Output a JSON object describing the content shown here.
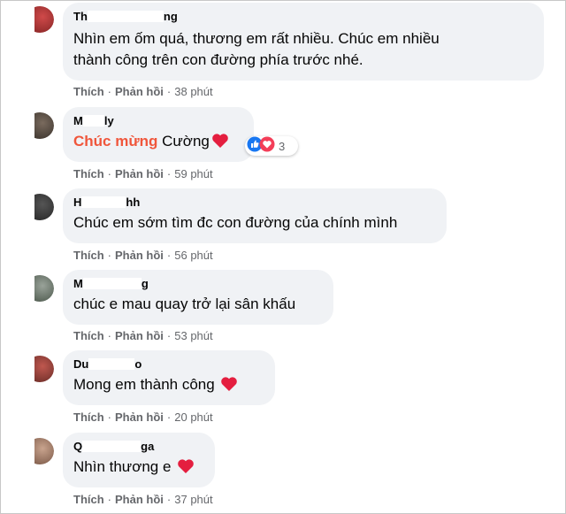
{
  "comments": [
    {
      "author_start": "Th",
      "author_end": "ng",
      "lines": [
        "Nhìn em ốm quá, thương em rất nhiều. Chúc em nhiều",
        "thành công trên con đường phía trước nhé."
      ],
      "like": "Thích",
      "reply": "Phản hồi",
      "time": "38 phút"
    },
    {
      "author_start": "M",
      "author_end": "ly",
      "celebrate": "Chúc mừng",
      "text": " Cường",
      "reaction_count": "3",
      "like": "Thích",
      "reply": "Phản hồi",
      "time": "59 phút"
    },
    {
      "author_start": "H",
      "author_end": "hh",
      "text": "Chúc em sớm tìm đc con đường của chính mình",
      "like": "Thích",
      "reply": "Phản hồi",
      "time": "56 phút"
    },
    {
      "author_start": "M",
      "author_end": "g",
      "text": "chúc e mau quay trở lại sân khấu",
      "like": "Thích",
      "reply": "Phản hồi",
      "time": "53 phút"
    },
    {
      "author_start": "Du",
      "author_end": "o",
      "text": "Mong em thành công",
      "like": "Thích",
      "reply": "Phản hồi",
      "time": "20 phút"
    },
    {
      "author_start": "Q",
      "author_end": "ga",
      "text": "Nhìn thương e",
      "like": "Thích",
      "reply": "Phản hồi",
      "time": "37 phút"
    }
  ],
  "separator": "·",
  "colors": {
    "bubble": "#f0f2f5",
    "meta": "#65676b",
    "celebrate": "#f0563b",
    "heart": "#e41e3f",
    "like_blue": "#1877f2"
  },
  "icons": {
    "heart": "heart-icon",
    "like": "like-reaction-icon",
    "love": "love-reaction-icon"
  }
}
